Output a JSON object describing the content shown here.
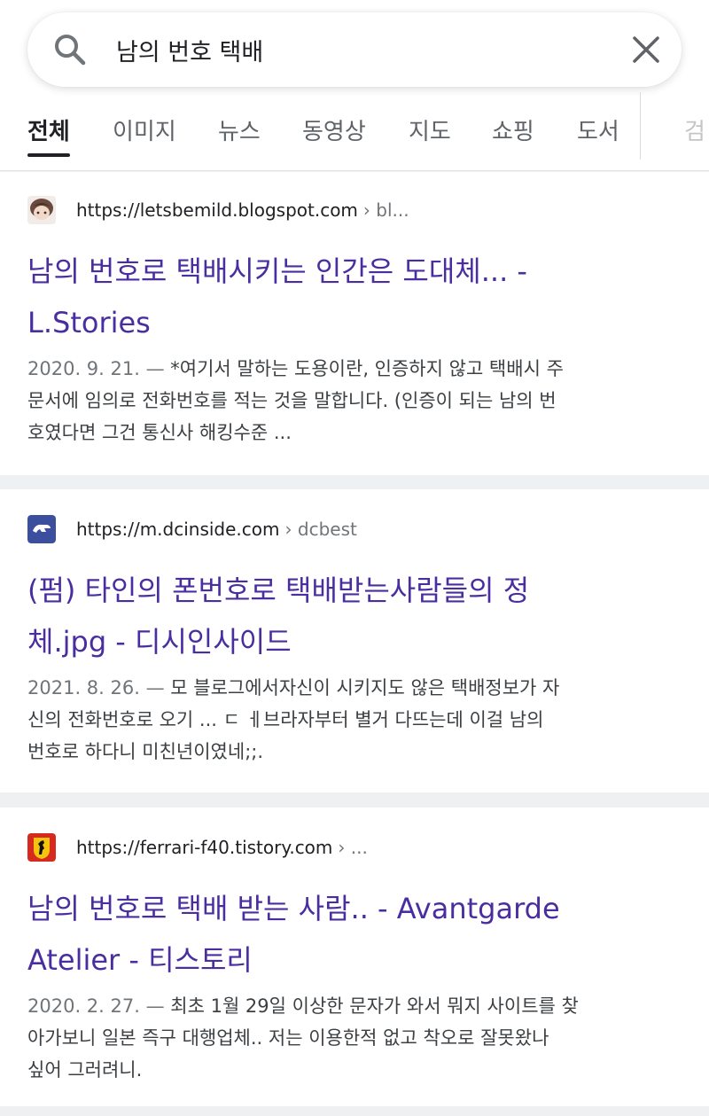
{
  "search": {
    "query": "남의 번호 택배"
  },
  "tabs": [
    {
      "label": "전체"
    },
    {
      "label": "이미지"
    },
    {
      "label": "뉴스"
    },
    {
      "label": "동영상"
    },
    {
      "label": "지도"
    },
    {
      "label": "쇼핑"
    },
    {
      "label": "도서"
    },
    {
      "label": "검"
    }
  ],
  "results": [
    {
      "url": "https://letsbemild.blogspot.com",
      "breadcrumb": "› bl...",
      "title_line1": "남의 번호로 택배시키는 인간은 도대체... -",
      "title_line2": "L.Stories",
      "date": "2020. 9. 21. —",
      "snippet_line1": "*여기서 말하는 도용이란, 인증하지 않고 택배시 주",
      "snippet_line2": "문서에 임의로 전화번호를 적는 것을 말합니다. (인증이 되는 남의 번",
      "snippet_line3": "호였다면 그건 통신사 해킹수준 ..."
    },
    {
      "url": "https://m.dcinside.com",
      "breadcrumb": "› dcbest",
      "title_line1": "(펌) 타인의 폰번호로 택배받는사람들의 정",
      "title_line2": "체.jpg - 디시인사이드",
      "date": "2021. 8. 26. —",
      "snippet_line1": "모 블로그에서자신이 시키지도 않은 택배정보가 자",
      "snippet_line2": "신의 전화번호로 오기 ... ㄷ ㅔ브라자부터 별거 다뜨는데 이걸 남의",
      "snippet_line3": "번호로 하다니 미친년이였네;;."
    },
    {
      "url": "https://ferrari-f40.tistory.com",
      "breadcrumb": "› ...",
      "title_line1": "남의 번호로 택배 받는 사람.. - Avantgarde",
      "title_line2": "Atelier - 티스토리",
      "date": "2020. 2. 27. —",
      "snippet_line1": "최초 1월 29일 이상한 문자가 와서 뭐지 사이트를 찾",
      "snippet_line2": "아가보니 일본 즉구 대행업체.. 저는 이용한적 없고 착오로 잘못왔나",
      "snippet_line3": "싶어 그러려니."
    }
  ],
  "colors": {
    "title": "#4a2ea0",
    "separator": "#eef0f2",
    "favicon_dcinside": "#3b4f9e",
    "favicon_ferrari": "#d62a1e"
  }
}
